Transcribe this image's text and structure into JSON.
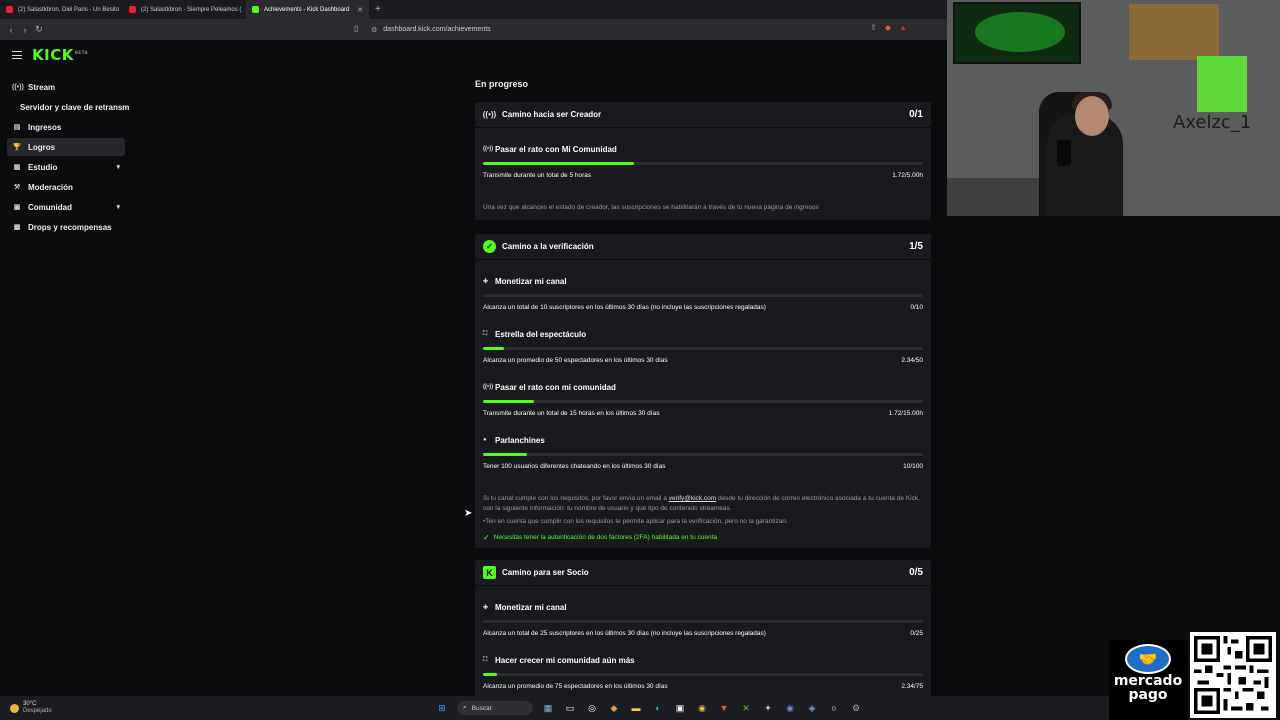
{
  "browser": {
    "tabs": [
      {
        "label": "(2) Salastkbron, Diel Paris - Un Besito",
        "favicon": "#e8242c"
      },
      {
        "label": "(2) Salastkbron - Siempre Peleamos (",
        "favicon": "#e8242c"
      },
      {
        "label": "Achievements - Kick Dashboard",
        "favicon": "#53fc18"
      }
    ],
    "url": "dashboard.kick.com/achievements"
  },
  "app": {
    "logo": "KICK",
    "logo_badge": "BETA"
  },
  "sidebar": {
    "items": [
      {
        "label": "Stream",
        "icon": "broadcast-icon"
      },
      {
        "label": "Servidor y clave de retransm",
        "sub": true
      },
      {
        "label": "Ingresos",
        "icon": "wallet-icon"
      },
      {
        "label": "Logros",
        "icon": "trophy-icon",
        "active": true
      },
      {
        "label": "Estudio",
        "icon": "studio-icon",
        "chevron": true
      },
      {
        "label": "Moderación",
        "icon": "hammer-icon"
      },
      {
        "label": "Comunidad",
        "icon": "people-icon",
        "chevron": true
      },
      {
        "label": "Drops y recompensas",
        "icon": "gift-icon"
      }
    ]
  },
  "main": {
    "section_title": "En progreso",
    "cards": [
      {
        "title": "Camino hacia ser Creador",
        "count": "0/1",
        "tasks": [
          {
            "title": "Pasar el rato con Mi Comunidad",
            "desc": "Transmite durante un total de 5 horas",
            "value": "1.72/5.00h",
            "progress": 0.344
          }
        ],
        "note": "Una vez que alcances el estado de creador, las suscripciones se habilitarán a través de tu nueva página de ingresos"
      },
      {
        "title": "Camino a la verificación",
        "count": "1/5",
        "tasks": [
          {
            "title": "Monetizar mi canal",
            "desc": "Alcanza un total de 10 suscriptores en los últimos 30 días (no incluye las suscripciones regaladas)",
            "value": "0/10",
            "progress": 0
          },
          {
            "title": "Estrella del espectáculo",
            "desc": "Alcanza un promedio de 50 espectadores en los últimos 30 días",
            "value": "2.34/50",
            "progress": 0.047
          },
          {
            "title": "Pasar el rato con mi comunidad",
            "desc": "Transmite durante un total de 15 horas en los últimos 30 días",
            "value": "1.72/15.00h",
            "progress": 0.115
          },
          {
            "title": "Parlanchines",
            "desc": "Tener 100 usuarios diferentes chateando en los últimos 30 días",
            "value": "10/100",
            "progress": 0.1
          }
        ],
        "note_before": "Si tu canal cumple con los requisitos, por favor envía un email a",
        "note_link": "verify@kick.com",
        "note_after": "desde tu dirección de correo electrónico asociada a tu cuenta de Kick, con la siguiente información: tu nombre de usuario y qué tipo de contenido streameas.",
        "note2": "•Ten en cuenta que cumplir con los requisitos te permite aplicar para la verificación, pero no la garantizan.",
        "twofa": "Necesitas tener la autenticación de dos factores (2FA) habilitada en tu cuenta"
      },
      {
        "title": "Camino para ser Socio",
        "count": "0/5",
        "tasks": [
          {
            "title": "Monetizar mi canal",
            "desc": "Alcanza un total de 25 suscriptores en los últimos 30 días (no incluye las suscripciones regaladas)",
            "value": "0/25",
            "progress": 0
          },
          {
            "title": "Hacer crecer mi comunidad aún más",
            "desc": "Alcanza un promedio de 75 espectadores en los últimos 30 días",
            "value": "2.34/75",
            "progress": 0.031
          }
        ]
      }
    ]
  },
  "overlay": {
    "streamer_name": "Axelzc_1",
    "mp_line1": "mercado",
    "mp_line2": "pago"
  },
  "taskbar": {
    "temp": "30°C",
    "weather": "Despejado",
    "search": "Buscar"
  },
  "colors": {
    "accent": "#53fc18",
    "panel": "#191a1d",
    "bg": "#0b0c0e"
  }
}
